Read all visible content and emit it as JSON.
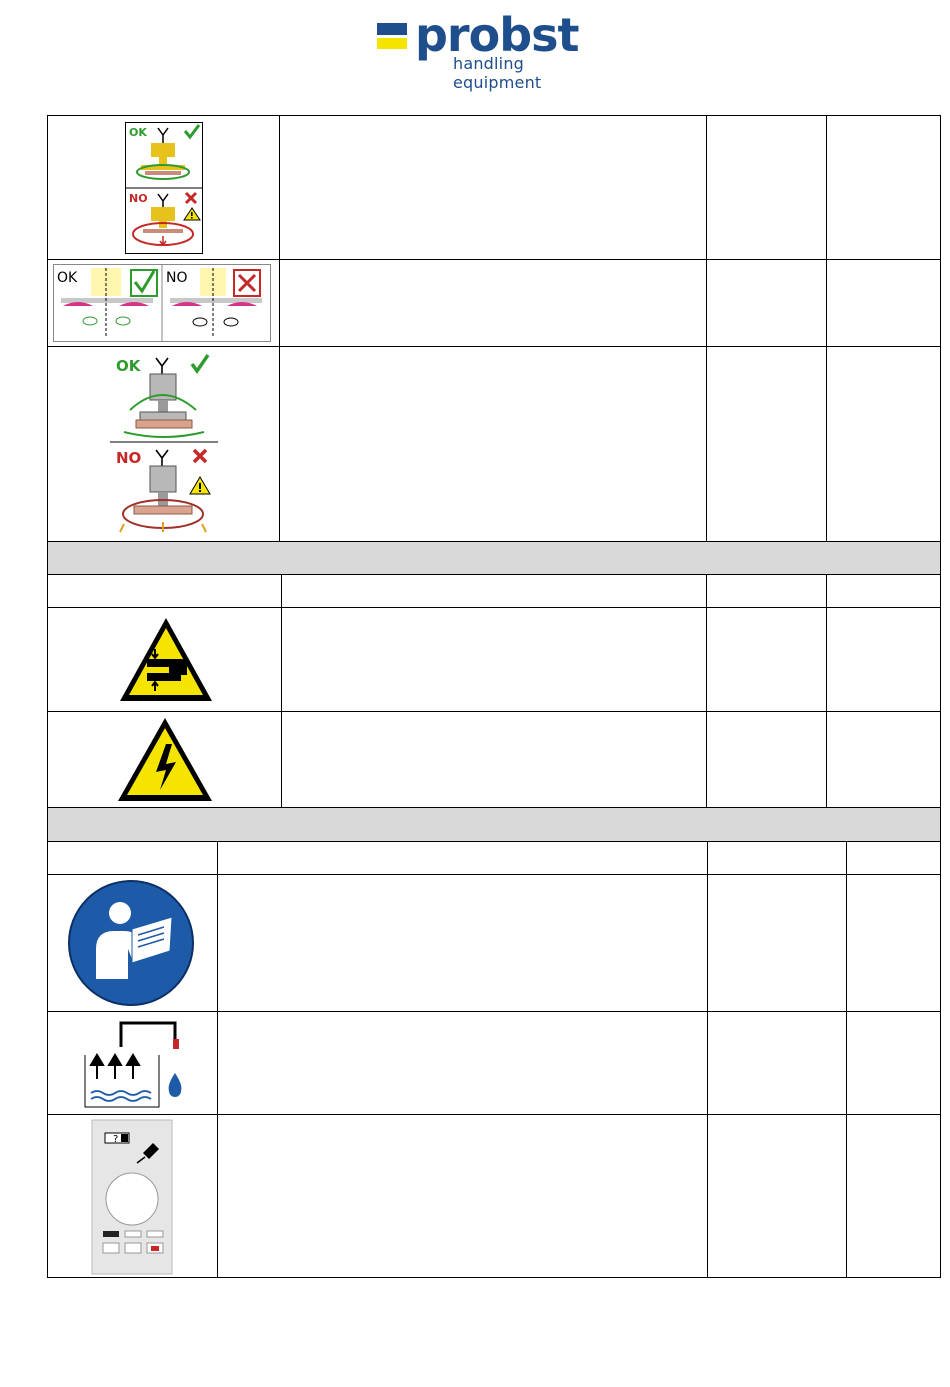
{
  "header": {
    "brand": "probst",
    "tagline": "handling equipment"
  },
  "section1": {
    "rows": [
      {
        "icon": "lifting-position-ok-no-icon",
        "labels": {
          "ok": "OK",
          "no": "NO"
        }
      },
      {
        "icon": "vacuum-plate-alignment-icon",
        "labels": {
          "ok": "OK",
          "no": "NO"
        }
      },
      {
        "icon": "lifting-load-ok-no-icon",
        "labels": {
          "ok": "OK",
          "no": "NO"
        }
      }
    ]
  },
  "section2": {
    "rows": [
      {
        "icon": "crush-hazard-warning-icon"
      },
      {
        "icon": "electrical-hazard-warning-icon"
      }
    ]
  },
  "section3": {
    "rows": [
      {
        "icon": "read-manual-icon"
      },
      {
        "icon": "water-drain-icon"
      },
      {
        "icon": "remote-control-battery-icon"
      }
    ]
  },
  "colors": {
    "brand_blue": "#1e4e8c",
    "brand_yellow": "#f5e400",
    "ok_green": "#2e9b2e",
    "no_red": "#c62828",
    "section_band": "#d9d9d9",
    "mandatory_blue": "#1d5aa7"
  }
}
